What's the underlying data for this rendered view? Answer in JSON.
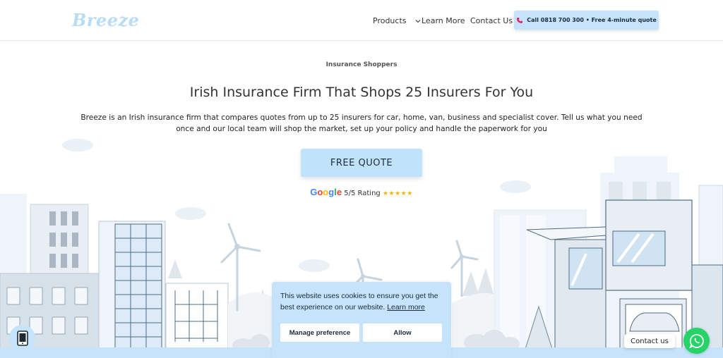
{
  "header": {
    "logo_text": "Breeze",
    "nav": {
      "products": "Products",
      "learn_more": "Learn More",
      "contact_us": "Contact Us"
    },
    "call_button": "Call 0818 700 300 • Free 4-minute quote"
  },
  "hero": {
    "eyebrow": "Insurance Shoppers",
    "title": "Irish Insurance Firm That Shops 25 Insurers For You",
    "subtitle": "Breeze is an Irish insurance firm that compares quotes from up to 25 insurers for car, home, van, business and specialist cover. Tell us what you need once and our local team will shop the market, set up your policy and handle the paperwork for you",
    "cta": "FREE QUOTE",
    "rating": {
      "brand": "Google",
      "text": "5/5 Rating",
      "stars": "★★★★★",
      "value": 5,
      "max": 5
    }
  },
  "cookie": {
    "message": "This website uses cookies to ensure you get the best experience on our website.",
    "learn_more": "Learn more",
    "manage_button": "Manage preference",
    "allow_button": "Allow"
  },
  "widgets": {
    "contact_bubble": "Contact us"
  },
  "colors": {
    "accent_light_blue": "#c5e4fb",
    "logo": "#b9dcf5",
    "whatsapp_green": "#25d366",
    "star_gold": "#f4b400"
  },
  "icons": [
    "chevron-down-icon",
    "phone-icon",
    "mobile-phone-icon",
    "whatsapp-icon"
  ]
}
